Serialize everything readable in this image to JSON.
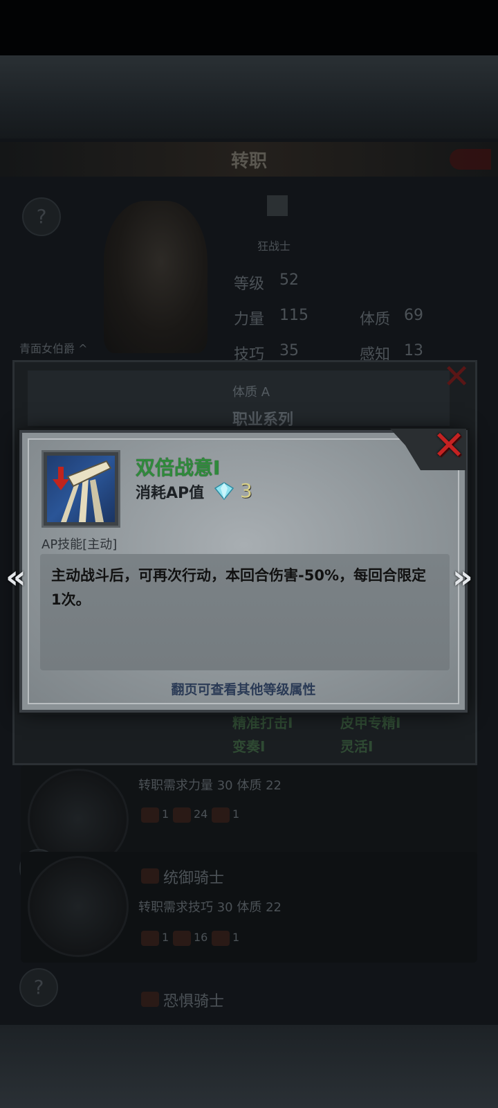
{
  "background": {
    "title": "转职",
    "character": {
      "class_name": "狂战士",
      "level_label": "等级",
      "level": "52",
      "strength_label": "力量",
      "strength": "115",
      "constitution_label": "体质",
      "constitution": "69",
      "skill_label": "技巧",
      "skill": "35",
      "perception_label": "感知",
      "perception": "13",
      "name": "青面女伯爵 ^"
    },
    "panel": {
      "constitution_grade": "体质 A",
      "class_series": "职业系列",
      "skills": [
        "精准打击I",
        "皮甲专精I",
        "变奏I",
        "灵活I"
      ]
    },
    "rows": [
      {
        "requirement": "转职需求力量 30 体质 22",
        "costs": [
          "1",
          "24",
          "1"
        ]
      },
      {
        "name": "统御骑士",
        "requirement": "转职需求技巧 30 体质 22",
        "costs": [
          "1",
          "16",
          "1"
        ]
      },
      {
        "name": "恐惧骑士"
      }
    ]
  },
  "dialog": {
    "skill_name": "双倍战意I",
    "cost_label": "消耗AP值",
    "cost_icon": "diamond-gem-icon",
    "cost_value": "3",
    "skill_type": "AP技能[主动]",
    "description": "主动战斗后，可再次行动，本回合伤害-50%，每回合限定1次。",
    "hint": "翻页可查看其他等级属性",
    "prev_arrow": "«",
    "next_arrow": "»",
    "close_icon": "close-x-icon"
  },
  "colors": {
    "skill_name": "#2f8a3b",
    "close": "#c42222",
    "hint": "#2a3a55"
  }
}
